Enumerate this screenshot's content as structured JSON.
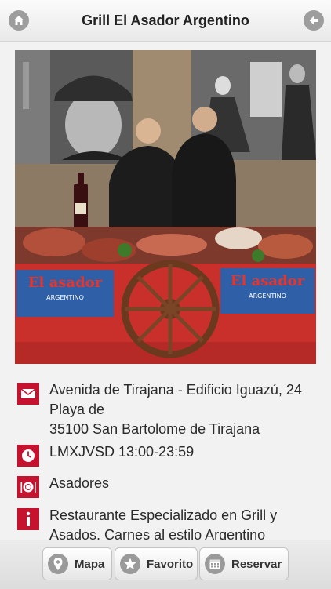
{
  "header": {
    "title": "Grill El Asador Argentino",
    "home_icon": "home-icon",
    "back_icon": "back-arrow-icon"
  },
  "photo": {
    "banner_text_left": "El asador",
    "banner_sub_left": "ARGENTINO",
    "banner_text_right": "El asador",
    "banner_sub_right": "ARGENTINO"
  },
  "info": {
    "address": {
      "icon": "envelope-icon",
      "lines": [
        "Avenida de Tirajana - Edificio Iguazú, 24",
        "Playa de",
        "35100 San Bartolome de Tirajana"
      ]
    },
    "hours": {
      "icon": "clock-icon",
      "text": "LMXJVSD 13:00-23:59"
    },
    "category": {
      "icon": "plate-cutlery-icon",
      "text": "Asadores"
    },
    "description": {
      "icon": "info-icon",
      "lines": [
        "Restaurante Especializado en Grill y",
        "Asados. Carnes al estilo Argentino"
      ]
    }
  },
  "toolbar": {
    "map_label": "Mapa",
    "favorite_label": "Favorito",
    "reserve_label": "Reservar"
  },
  "colors": {
    "accent": "#c4122f",
    "icon_gray": "#9d9d9d",
    "background": "#f2f2f2"
  }
}
